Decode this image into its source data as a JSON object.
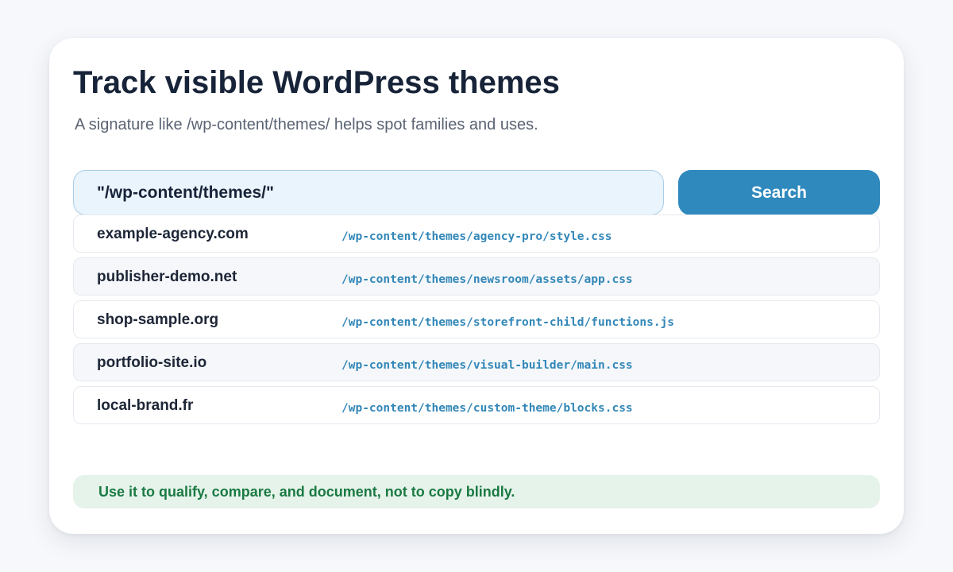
{
  "header": {
    "title": "Track visible WordPress themes",
    "subtitle": "A signature like /wp-content/themes/ helps spot families and uses."
  },
  "search": {
    "value": "\"/wp-content/themes/\"",
    "button_label": "Search"
  },
  "results": [
    {
      "domain": "example-agency.com",
      "path": "/wp-content/themes/agency-pro/style.css"
    },
    {
      "domain": "publisher-demo.net",
      "path": "/wp-content/themes/newsroom/assets/app.css"
    },
    {
      "domain": "shop-sample.org",
      "path": "/wp-content/themes/storefront-child/functions.js"
    },
    {
      "domain": "portfolio-site.io",
      "path": "/wp-content/themes/visual-builder/main.css"
    },
    {
      "domain": "local-brand.fr",
      "path": "/wp-content/themes/custom-theme/blocks.css"
    }
  ],
  "note": {
    "text": "Use it to qualify, compare, and document, not to copy blindly."
  },
  "colors": {
    "accent": "#2f89bd",
    "title": "#172338",
    "path": "#3287b8",
    "note_text": "#1a7a43",
    "note_bg": "#e6f3ea"
  }
}
